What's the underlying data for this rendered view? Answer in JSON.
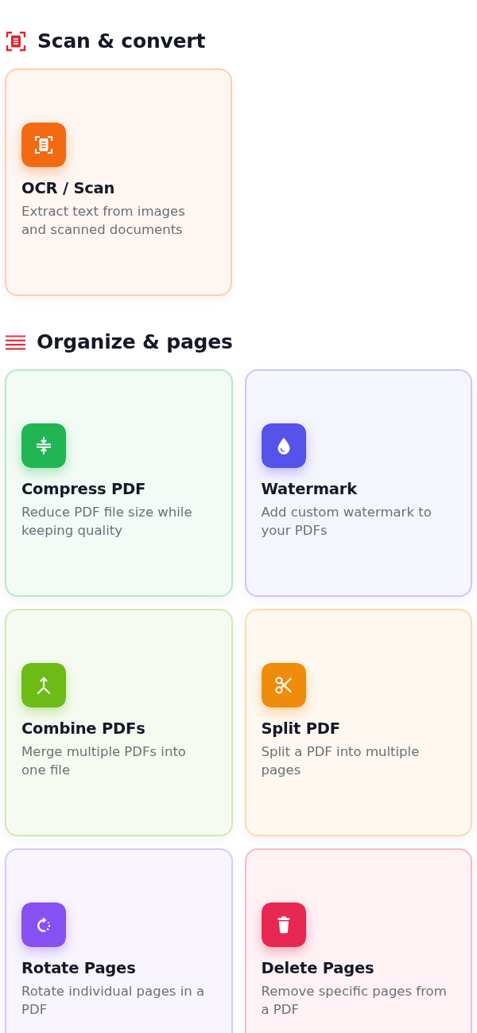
{
  "sections": [
    {
      "kind": "scan",
      "title": "Scan & convert",
      "tools": [
        {
          "kind": "scan",
          "title": "OCR / Scan",
          "description": "Extract text from images and scanned documents",
          "color": "#f26b12"
        }
      ]
    },
    {
      "kind": "organize",
      "title": "Organize & pages",
      "tools": [
        {
          "kind": "compress",
          "title": "Compress PDF",
          "description": "Reduce PDF file size while keeping quality",
          "color": "#21b653"
        },
        {
          "kind": "watermark",
          "title": "Watermark",
          "description": "Add custom watermark to your PDFs",
          "color": "#5553ea"
        },
        {
          "kind": "combine",
          "title": "Combine PDFs",
          "description": "Merge multiple PDFs into one file",
          "color": "#6dbb16"
        },
        {
          "kind": "split",
          "title": "Split PDF",
          "description": "Split a PDF into multiple pages",
          "color": "#ef8c0b"
        },
        {
          "kind": "rotate",
          "title": "Rotate Pages",
          "description": "Rotate individual pages in a PDF",
          "color": "#8650f2"
        },
        {
          "kind": "delete",
          "title": "Delete Pages",
          "description": "Remove specific pages from a PDF",
          "color": "#e62850"
        }
      ]
    }
  ]
}
